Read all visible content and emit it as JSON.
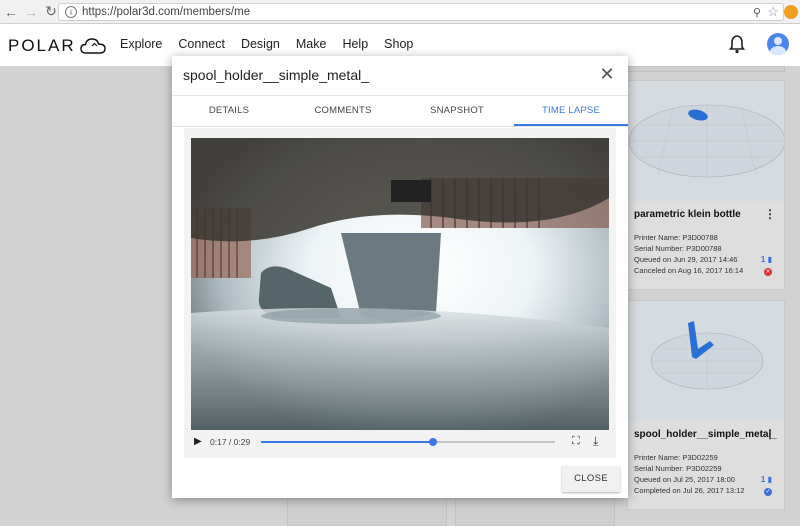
{
  "browser": {
    "url": "https://polar3d.com/members/me"
  },
  "header": {
    "logo_text": "POLAR",
    "nav": [
      "Explore",
      "Connect",
      "Design",
      "Make",
      "Help",
      "Shop"
    ]
  },
  "dialog": {
    "title": "spool_holder__simple_metal_",
    "tabs": [
      {
        "label": "DETAILS",
        "active": false
      },
      {
        "label": "COMMENTS",
        "active": false
      },
      {
        "label": "SNAPSHOT",
        "active": false
      },
      {
        "label": "TIME LAPSE",
        "active": true
      }
    ],
    "player": {
      "time": "0:17 / 0:29",
      "progress": 0.586
    },
    "close_label": "CLOSE"
  },
  "cards": [
    {
      "title": "parametric klein bottle",
      "printer": "Printer Name: P3D00788",
      "serial": "Serial Number: P3D00788",
      "queued": "Queued on Jun 29, 2017 14:46",
      "finished": "Canceled on Aug 16, 2017 16:14",
      "count": "1",
      "status": "canceled"
    },
    {
      "title": "spool_holder__simple_metal_",
      "printer": "Printer Name: P3D02259",
      "serial": "Serial Number: P3D02259",
      "queued": "Queued on Jul 25, 2017 18:00",
      "finished": "Completed on Jul 26, 2017 13:12",
      "count": "1",
      "status": "completed"
    }
  ],
  "colors": {
    "accent": "#3b78e7",
    "canceled": "#dd3333",
    "model_blue": "#2a6fd6"
  }
}
